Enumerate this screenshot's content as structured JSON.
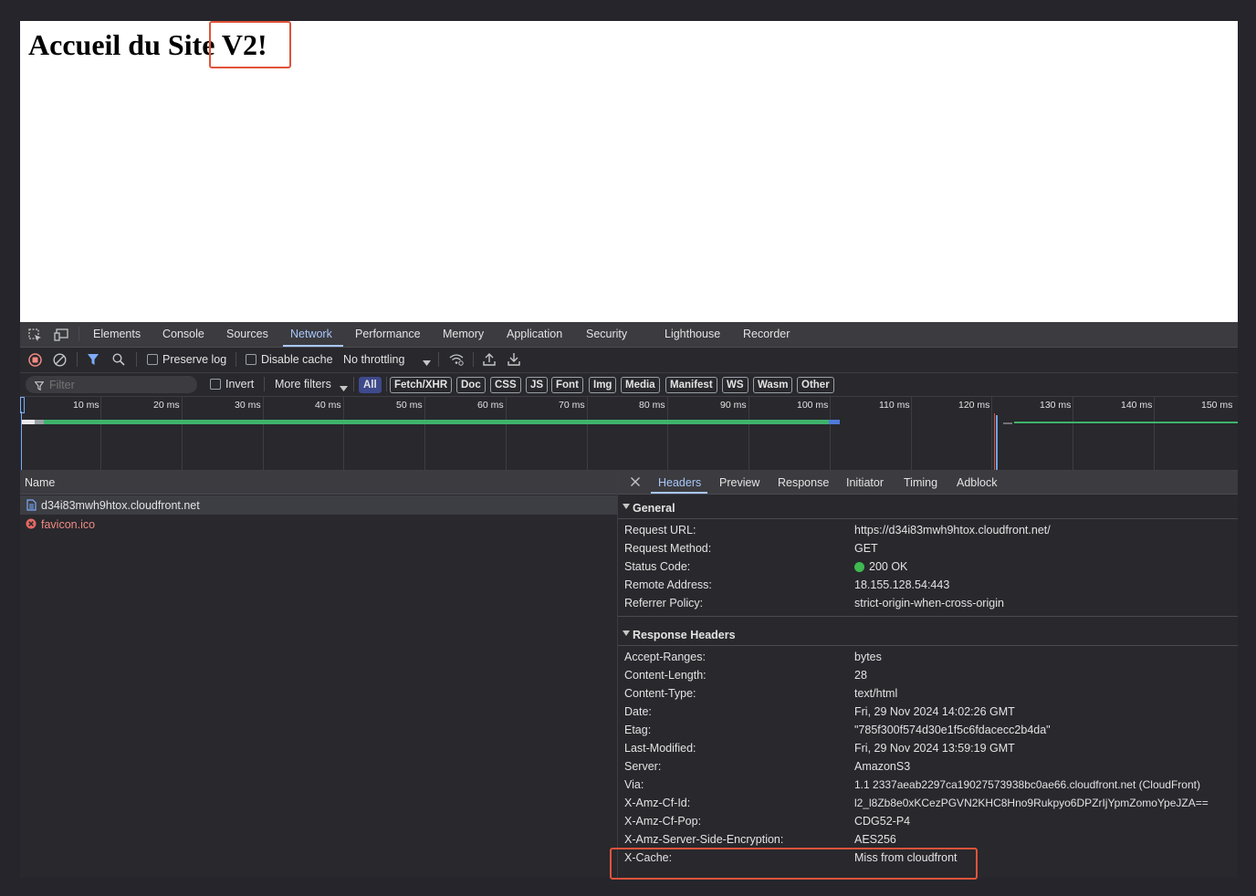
{
  "page": {
    "heading_main": "Accueil du Site ",
    "heading_version": "V2!"
  },
  "devtools": {
    "tabs": [
      "Elements",
      "Console",
      "Sources",
      "Network",
      "Performance",
      "Memory",
      "Application",
      "Security",
      "Lighthouse",
      "Recorder"
    ],
    "active_tab": "Network",
    "toolbar": {
      "preserve_log": "Preserve log",
      "disable_cache": "Disable cache",
      "throttling": "No throttling"
    },
    "filter": {
      "placeholder": "Filter",
      "invert": "Invert",
      "more_filters": "More filters",
      "types": [
        "All",
        "Fetch/XHR",
        "Doc",
        "CSS",
        "JS",
        "Font",
        "Img",
        "Media",
        "Manifest",
        "WS",
        "Wasm",
        "Other"
      ],
      "active_type": "All"
    },
    "timeline": {
      "ticks": [
        "10 ms",
        "20 ms",
        "30 ms",
        "40 ms",
        "50 ms",
        "60 ms",
        "70 ms",
        "80 ms",
        "90 ms",
        "100 ms",
        "110 ms",
        "120 ms",
        "130 ms",
        "140 ms",
        "150 ms"
      ],
      "colors": {
        "doc_bar": "#3fb36b",
        "doc_bar_end": "#4f7ad8",
        "load_line": "#e0533a",
        "dom_line": "#6ba4e8"
      }
    },
    "requests": {
      "header": "Name",
      "items": [
        {
          "name": "d34i83mwh9htox.cloudfront.net",
          "status": "ok",
          "icon": "document-icon"
        },
        {
          "name": "favicon.ico",
          "status": "error",
          "icon": "error-icon"
        }
      ]
    },
    "details": {
      "tabs": [
        "Headers",
        "Preview",
        "Response",
        "Initiator",
        "Timing",
        "Adblock"
      ],
      "active_tab": "Headers",
      "general": {
        "title": "General",
        "rows": [
          {
            "key": "Request URL:",
            "value": "https://d34i83mwh9htox.cloudfront.net/"
          },
          {
            "key": "Request Method:",
            "value": "GET"
          },
          {
            "key": "Status Code:",
            "value": "200 OK"
          },
          {
            "key": "Remote Address:",
            "value": "18.155.128.54:443"
          },
          {
            "key": "Referrer Policy:",
            "value": "strict-origin-when-cross-origin"
          }
        ]
      },
      "response_headers": {
        "title": "Response Headers",
        "rows": [
          {
            "key": "Accept-Ranges:",
            "value": "bytes"
          },
          {
            "key": "Content-Length:",
            "value": "28"
          },
          {
            "key": "Content-Type:",
            "value": "text/html"
          },
          {
            "key": "Date:",
            "value": "Fri, 29 Nov 2024 14:02:26 GMT"
          },
          {
            "key": "Etag:",
            "value": "\"785f300f574d30e1f5c6fdacecc2b4da\""
          },
          {
            "key": "Last-Modified:",
            "value": "Fri, 29 Nov 2024 13:59:19 GMT"
          },
          {
            "key": "Server:",
            "value": "AmazonS3"
          },
          {
            "key": "Via:",
            "value": "1.1 2337aeab2297ca19027573938bc0ae66.cloudfront.net (CloudFront)"
          },
          {
            "key": "X-Amz-Cf-Id:",
            "value": "l2_l8Zb8e0xKCezPGVN2KHC8Hno9Rukpyo6DPZrIjYpmZomoYpeJZA=="
          },
          {
            "key": "X-Amz-Cf-Pop:",
            "value": "CDG52-P4"
          },
          {
            "key": "X-Amz-Server-Side-Encryption:",
            "value": "AES256"
          },
          {
            "key": "X-Cache:",
            "value": "Miss from cloudfront"
          }
        ]
      }
    },
    "colors": {
      "highlight": "#e0533a",
      "accent": "#a8c7fa",
      "status_ok": "#3fb950",
      "error": "#f28b82"
    }
  }
}
